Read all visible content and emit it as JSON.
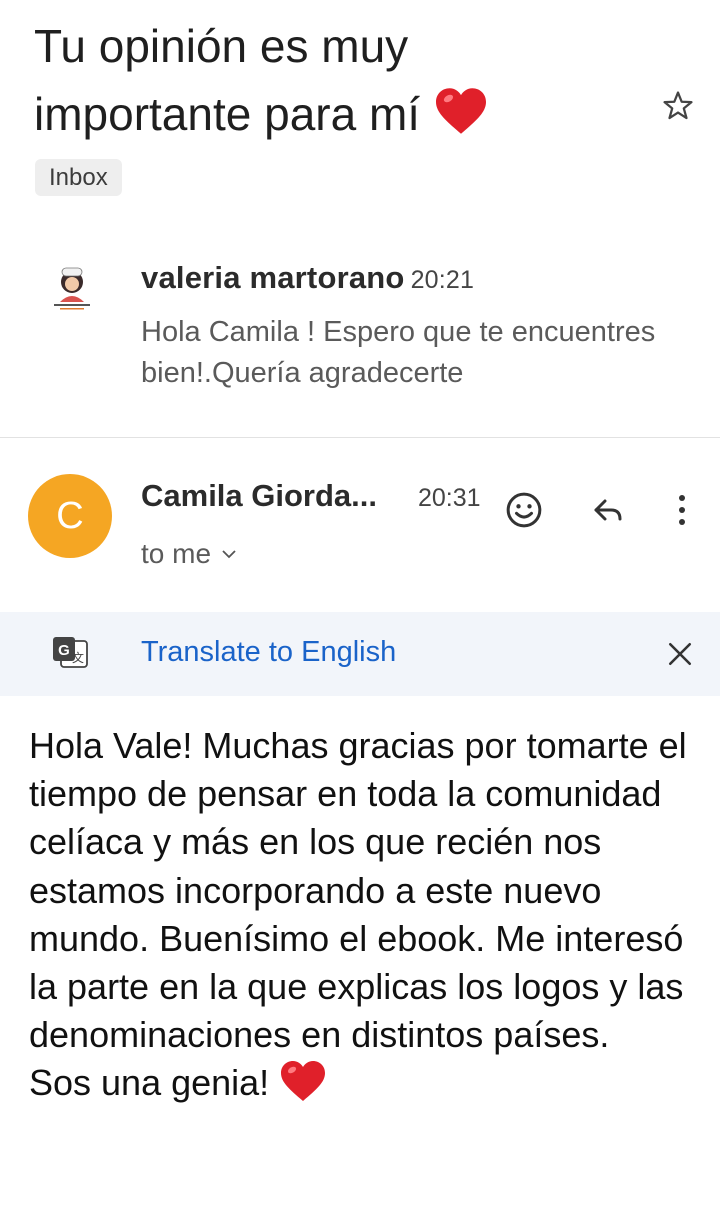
{
  "email": {
    "subject": "Tu opinión es muy importante para mí",
    "subject_emoji": "❤️",
    "label": "Inbox",
    "star_icon": "star-outline-icon"
  },
  "messages": [
    {
      "sender": "valeria martorano",
      "time": "20:21",
      "snippet": "Hola Camila ! Espero que te encuentres bien!.Quería agradecerte",
      "avatar": "profile-logo-icon"
    },
    {
      "sender": "Camila Giorda...",
      "time": "20:31",
      "avatar_letter": "C",
      "avatar_color": "#f5a623",
      "recipient": "to me",
      "actions": [
        "emoji-reaction-icon",
        "reply-icon",
        "more-vert-icon"
      ]
    }
  ],
  "translate": {
    "label": "Translate to English",
    "link_color": "#1a63c9"
  },
  "body": {
    "paragraph": "Hola Vale! Muchas gracias por tomarte el tiempo de pensar en toda la comunidad celíaca y más en los que recién nos estamos incorporando a este nuevo mundo. Buenísimo el ebook. Me interesó la parte en la que explicas los logos y las denominaciones en distintos países.",
    "closing": "Sos una genia!",
    "closing_emoji": "❤️"
  }
}
